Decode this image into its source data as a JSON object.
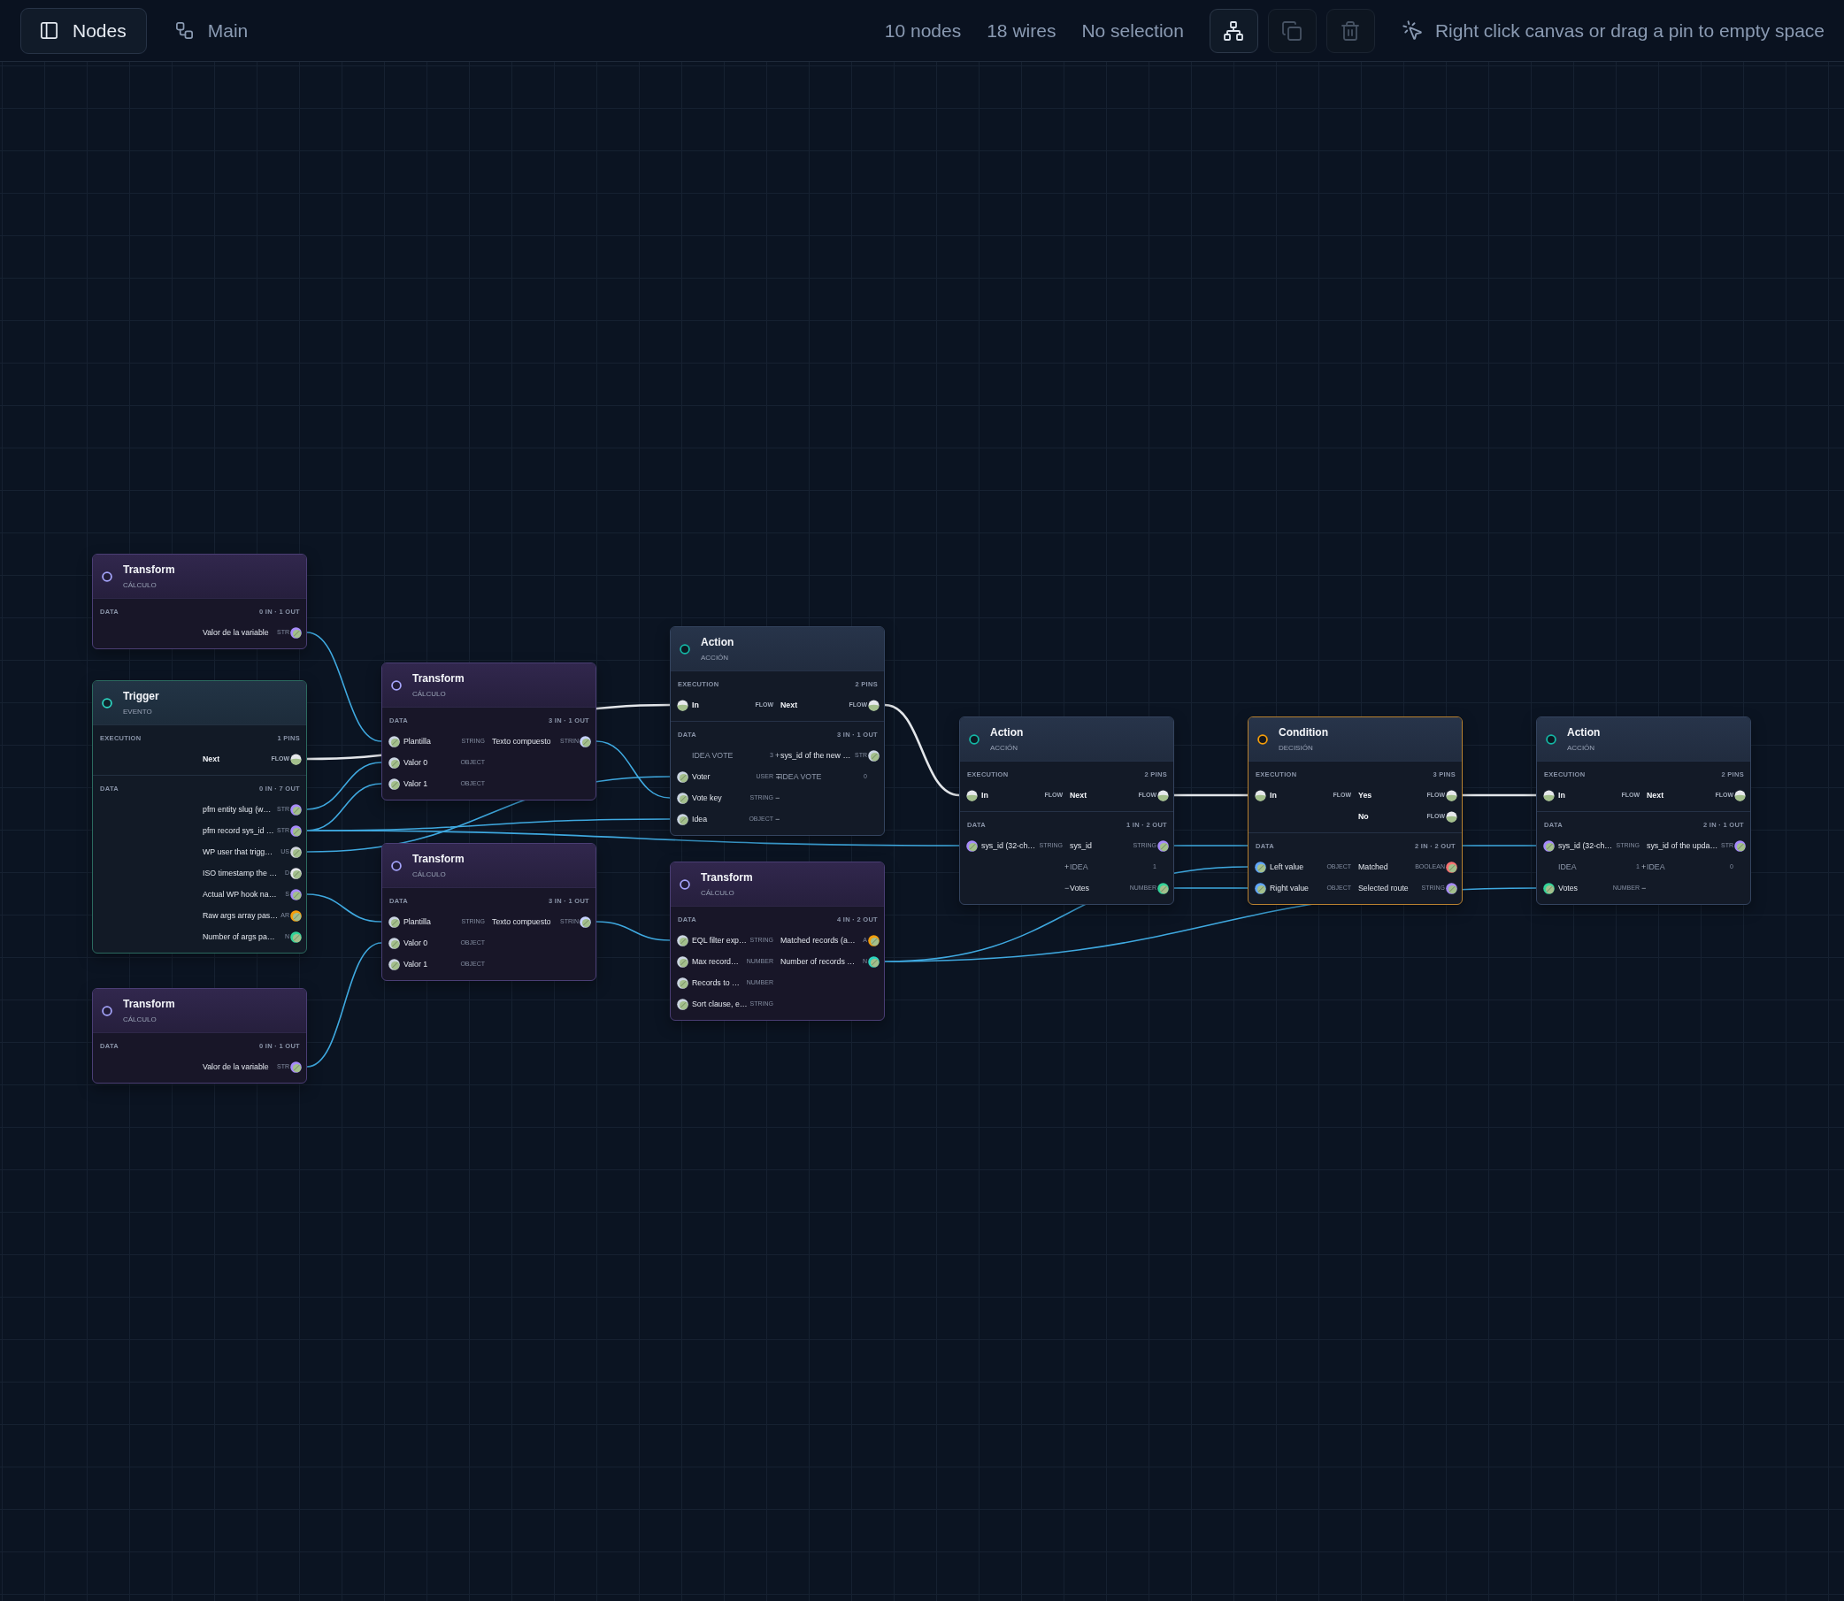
{
  "topbar": {
    "sidebar_toggle": {
      "label": "Nodes",
      "selected": true
    },
    "graph_name": "Main",
    "stats": [
      "10 nodes",
      "18 wires",
      "No selection"
    ],
    "tools": [
      {
        "kind": "layout",
        "disabled": false
      },
      {
        "kind": "duplicate",
        "disabled": true
      },
      {
        "kind": "delete",
        "disabled": true
      }
    ],
    "hint": "Right click canvas or drag a pin to empty space"
  },
  "nodes": [
    {
      "kind": "transform",
      "title": "Transform",
      "subtitle": "CÁLCULO",
      "sections": [
        {
          "title": "DATA",
          "summary": "0 IN · 1 OUT",
          "rows": [
            {
              "out": {
                "kind": "data",
                "label": "Valor de la variable",
                "type": "STR",
                "color": "#a78bfa"
              }
            }
          ]
        }
      ]
    },
    {
      "kind": "trigger",
      "title": "Trigger",
      "subtitle": "EVENTO",
      "sections": [
        {
          "title": "EXECUTION",
          "summary": "1 PINS",
          "rows": [
            {
              "out": {
                "kind": "flow",
                "label": "Next",
                "type": "FLOW"
              }
            }
          ]
        },
        {
          "title": "DATA",
          "summary": "0 IN · 7 OUT",
          "rows": [
            {
              "out": {
                "kind": "data",
                "label": "pfm entity slug (w…",
                "type": "STR",
                "color": "#a78bfa"
              }
            },
            {
              "out": {
                "kind": "data",
                "label": "pfm record sys_id …",
                "type": "STR",
                "color": "#a78bfa"
              }
            },
            {
              "out": {
                "kind": "data",
                "label": "WP user that trigg…",
                "type": "US",
                "color": "#d1d5db"
              }
            },
            {
              "out": {
                "kind": "data",
                "label": "ISO timestamp the …",
                "type": "D",
                "color": "#e5e7eb"
              }
            },
            {
              "out": {
                "kind": "data",
                "label": "Actual WP hook na…",
                "type": "S",
                "color": "#a78bfa"
              }
            },
            {
              "out": {
                "kind": "data",
                "label": "Raw args array pas…",
                "type": "AR",
                "color": "#f59e0b"
              }
            },
            {
              "out": {
                "kind": "data",
                "label": "Number of args pa…",
                "type": "N",
                "color": "#34d399"
              }
            }
          ]
        }
      ]
    },
    {
      "kind": "transform",
      "title": "Transform",
      "subtitle": "CÁLCULO",
      "sections": [
        {
          "title": "DATA",
          "summary": "0 IN · 1 OUT",
          "rows": [
            {
              "out": {
                "kind": "data",
                "label": "Valor de la variable",
                "type": "STR",
                "color": "#a78bfa"
              }
            }
          ]
        }
      ]
    },
    {
      "kind": "transform",
      "title": "Transform",
      "subtitle": "CÁLCULO",
      "sections": [
        {
          "title": "DATA",
          "summary": "3 IN · 1 OUT",
          "rows": [
            {
              "in": {
                "kind": "data",
                "label": "Plantilla",
                "type": "STRING",
                "color": "#cbd5e1"
              },
              "out": {
                "kind": "data",
                "label": "Texto compuesto",
                "type": "STRIN",
                "color": "#c7d2fe"
              }
            },
            {
              "in": {
                "kind": "data",
                "label": "Valor 0",
                "type": "OBJECT",
                "color": "#cbd5e1"
              }
            },
            {
              "in": {
                "kind": "data",
                "label": "Valor 1",
                "type": "OBJECT",
                "color": "#cbd5e1"
              }
            }
          ]
        }
      ]
    },
    {
      "kind": "transform",
      "title": "Transform",
      "subtitle": "CÁLCULO",
      "sections": [
        {
          "title": "DATA",
          "summary": "3 IN · 1 OUT",
          "rows": [
            {
              "in": {
                "kind": "data",
                "label": "Plantilla",
                "type": "STRING",
                "color": "#cbd5e1"
              },
              "out": {
                "kind": "data",
                "label": "Texto compuesto",
                "type": "STRIN",
                "color": "#c7d2fe"
              }
            },
            {
              "in": {
                "kind": "data",
                "label": "Valor 0",
                "type": "OBJECT",
                "color": "#cbd5e1"
              }
            },
            {
              "in": {
                "kind": "data",
                "label": "Valor 1",
                "type": "OBJECT",
                "color": "#cbd5e1"
              }
            }
          ]
        }
      ]
    },
    {
      "kind": "action",
      "title": "Action",
      "subtitle": "ACCIÓN",
      "sections": [
        {
          "title": "EXECUTION",
          "summary": "2 PINS",
          "rows": [
            {
              "in": {
                "kind": "flow",
                "label": "In",
                "type": "FLOW"
              },
              "out": {
                "kind": "flow",
                "label": "Next",
                "type": "FLOW"
              }
            }
          ]
        },
        {
          "title": "DATA",
          "summary": "3 IN · 1 OUT",
          "rows": [
            {
              "in": {
                "kind": "value",
                "label": "IDEA VOTE",
                "type": "3"
              },
              "out": {
                "kind": "data",
                "prefix": "+",
                "label": "sys_id of the new …",
                "type": "STR",
                "color": "#cbd5e1"
              }
            },
            {
              "in": {
                "kind": "data",
                "label": "Voter",
                "type": "USER",
                "color": "#cbd5e1"
              },
              "out": {
                "kind": "value",
                "prefix": "∓",
                "label": "IDEA VOTE",
                "type": "0"
              }
            },
            {
              "in": {
                "kind": "data",
                "label": "Vote key",
                "type": "STRING",
                "color": "#cbd5e1"
              },
              "out": {
                "kind": "value",
                "prefix": "−"
              }
            },
            {
              "in": {
                "kind": "data",
                "label": "Idea",
                "type": "OBJECT",
                "color": "#cbd5e1"
              },
              "out": {
                "kind": "value",
                "prefix": "−"
              }
            }
          ]
        }
      ]
    },
    {
      "kind": "transform",
      "title": "Transform",
      "subtitle": "CÁLCULO",
      "sections": [
        {
          "title": "DATA",
          "summary": "4 IN · 2 OUT",
          "rows": [
            {
              "in": {
                "kind": "data",
                "label": "EQL filter exp…",
                "type": "STRING",
                "color": "#cbd5e1"
              },
              "out": {
                "kind": "data",
                "label": "Matched records (a…",
                "type": "A",
                "color": "#f59e0b"
              }
            },
            {
              "in": {
                "kind": "data",
                "label": "Max record…",
                "type": "NUMBER",
                "color": "#cbd5e1"
              },
              "out": {
                "kind": "data",
                "label": "Number of records …",
                "type": "N",
                "color": "#2dd4bf"
              }
            },
            {
              "in": {
                "kind": "data",
                "label": "Records to …",
                "type": "NUMBER",
                "color": "#cbd5e1"
              }
            },
            {
              "in": {
                "kind": "data",
                "label": "Sort clause, e…",
                "type": "STRING",
                "color": "#cbd5e1"
              }
            }
          ]
        }
      ]
    },
    {
      "kind": "action",
      "title": "Action",
      "subtitle": "ACCIÓN",
      "sections": [
        {
          "title": "EXECUTION",
          "summary": "2 PINS",
          "rows": [
            {
              "in": {
                "kind": "flow",
                "label": "In",
                "type": "FLOW"
              },
              "out": {
                "kind": "flow",
                "label": "Next",
                "type": "FLOW"
              }
            }
          ]
        },
        {
          "title": "DATA",
          "summary": "1 IN · 2 OUT",
          "rows": [
            {
              "in": {
                "kind": "data",
                "label": "sys_id (32-ch…",
                "type": "STRING",
                "color": "#a78bfa"
              },
              "out": {
                "kind": "data",
                "label": "sys_id",
                "type": "STRING",
                "color": "#a78bfa"
              }
            },
            {
              "out": {
                "kind": "value",
                "prefix": "+",
                "label": "IDEA",
                "type": "1"
              }
            },
            {
              "out": {
                "kind": "data",
                "prefix": "−",
                "label": "Votes",
                "type": "NUMBER",
                "color": "#34d399"
              }
            }
          ]
        }
      ]
    },
    {
      "kind": "condition",
      "title": "Condition",
      "subtitle": "DECISIÓN",
      "sections": [
        {
          "title": "EXECUTION",
          "summary": "3 PINS",
          "rows": [
            {
              "in": {
                "kind": "flow",
                "label": "In",
                "type": "FLOW"
              },
              "out": {
                "kind": "flow",
                "label": "Yes",
                "type": "FLOW"
              }
            },
            {
              "out": {
                "kind": "flow",
                "label": "No",
                "type": "FLOW"
              }
            }
          ]
        },
        {
          "title": "DATA",
          "summary": "2 IN · 2 OUT",
          "rows": [
            {
              "in": {
                "kind": "data",
                "label": "Left value",
                "type": "OBJECT",
                "color": "#60a5fa"
              },
              "out": {
                "kind": "data",
                "label": "Matched",
                "type": "BOOLEAN",
                "color": "#f87171"
              }
            },
            {
              "in": {
                "kind": "data",
                "label": "Right value",
                "type": "OBJECT",
                "color": "#60a5fa"
              },
              "out": {
                "kind": "data",
                "label": "Selected route",
                "type": "STRING",
                "color": "#a78bfa"
              }
            }
          ]
        }
      ]
    },
    {
      "kind": "action",
      "title": "Action",
      "subtitle": "ACCIÓN",
      "sections": [
        {
          "title": "EXECUTION",
          "summary": "2 PINS",
          "rows": [
            {
              "in": {
                "kind": "flow",
                "label": "In",
                "type": "FLOW"
              },
              "out": {
                "kind": "flow",
                "label": "Next",
                "type": "FLOW"
              }
            }
          ]
        },
        {
          "title": "DATA",
          "summary": "2 IN · 1 OUT",
          "rows": [
            {
              "in": {
                "kind": "data",
                "label": "sys_id (32-ch…",
                "type": "STRING",
                "color": "#a78bfa"
              },
              "out": {
                "kind": "data",
                "label": "sys_id of the upda…",
                "type": "STR",
                "color": "#a78bfa"
              }
            },
            {
              "in": {
                "kind": "value",
                "label": "IDEA",
                "type": "1"
              },
              "out": {
                "kind": "value",
                "prefix": "+",
                "label": "IDEA",
                "type": "0"
              }
            },
            {
              "in": {
                "kind": "data",
                "label": "Votes",
                "type": "NUMBER",
                "color": "#34d399"
              },
              "out": {
                "kind": "value",
                "prefix": "−"
              }
            }
          ]
        }
      ]
    }
  ]
}
